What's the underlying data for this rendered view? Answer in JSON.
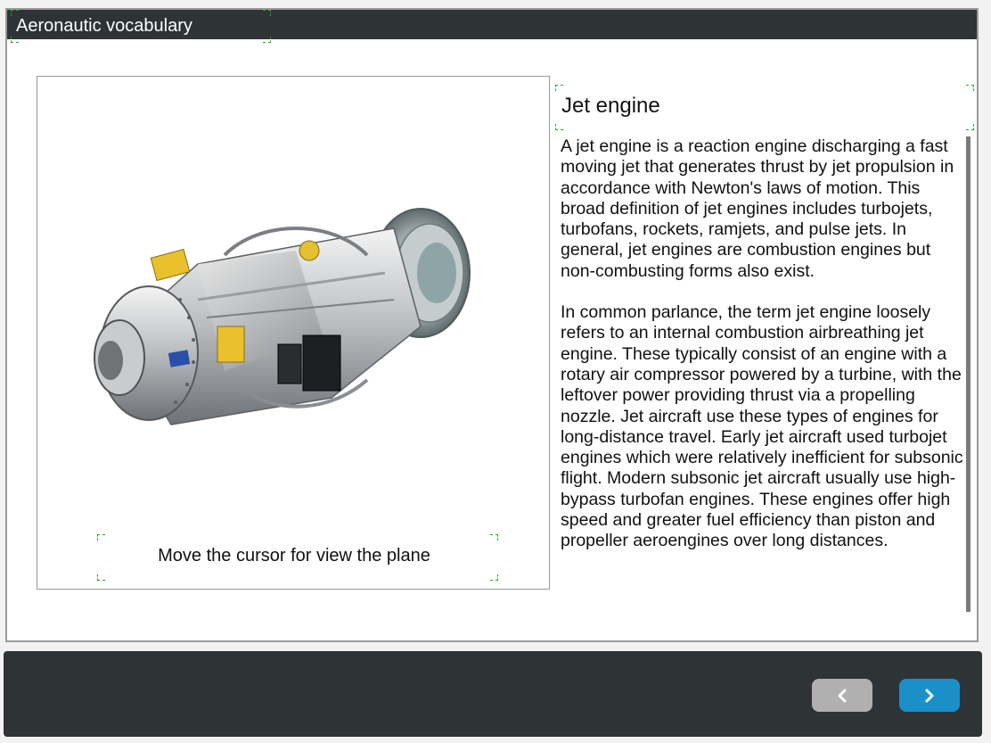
{
  "header": {
    "title": "Aeronautic vocabulary"
  },
  "media": {
    "image_alt": "turboprop engine",
    "caption": "Move the cursor for view the plane"
  },
  "article": {
    "heading": "Jet engine",
    "paragraphs": [
      "A jet engine is a reaction engine discharging a fast moving jet that generates thrust by jet propulsion in accordance with Newton's laws of motion. This broad definition of jet engines includes turbojets, turbofans, rockets, ramjets, and pulse jets. In general, jet engines are combustion engines but non-combusting forms also exist.",
      "In common parlance, the term jet engine loosely refers to an internal combustion airbreathing jet engine. These typically consist of an engine with a rotary air compressor powered by a turbine, with the leftover power providing thrust via a propelling nozzle. Jet aircraft use these types of engines for long-distance travel. Early jet aircraft used turbojet engines which were relatively inefficient for subsonic flight. Modern subsonic jet aircraft usually use high-bypass turbofan engines. These engines offer high speed and greater fuel efficiency than piston and propeller aeroengines over long distances."
    ]
  },
  "footer": {
    "prev_icon": "chevron-left-icon",
    "next_icon": "chevron-right-icon"
  },
  "colors": {
    "title_bar": "#2e3336",
    "next_button": "#1b8fc7",
    "prev_button_disabled": "#b0b0b0"
  }
}
